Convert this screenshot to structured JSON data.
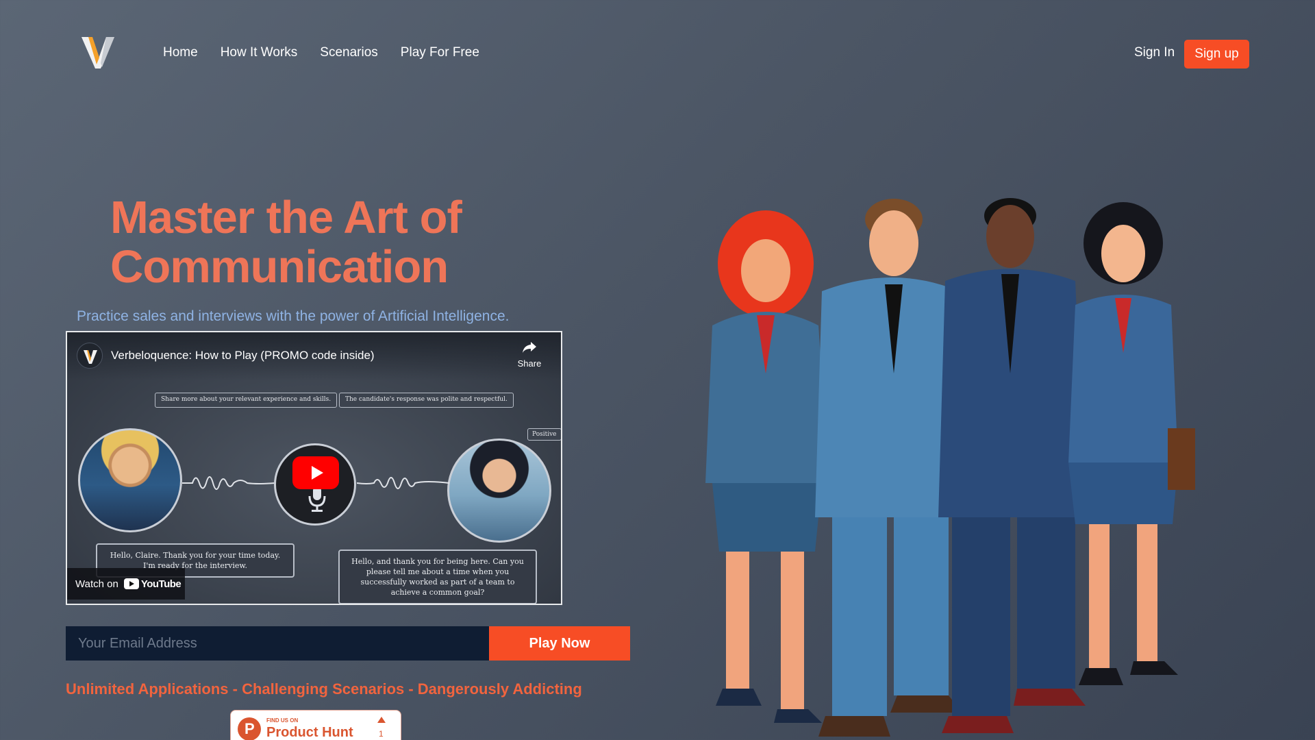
{
  "brand": {
    "logo_icon": "v-logo-icon",
    "accent": "#f74d25"
  },
  "nav": {
    "items": [
      {
        "label": "Home"
      },
      {
        "label": "How It Works"
      },
      {
        "label": "Scenarios"
      },
      {
        "label": "Play For Free"
      }
    ],
    "sign_in": "Sign In",
    "sign_up": "Sign up"
  },
  "hero": {
    "title_line1": "Master the Art of",
    "title_line2": "Communication",
    "subtitle": "Practice sales and interviews with the power of Artificial Intelligence."
  },
  "video": {
    "title": "Verbeloquence: How to Play (PROMO code inside)",
    "share_label": "Share",
    "prompt_left": "Share more about your relevant experience and skills.",
    "prompt_right": "The candidate's response was polite and respectful.",
    "tag": "Positive",
    "bubble_left": "Hello, Claire. Thank you for your time today. I'm ready for the interview.",
    "bubble_right": "Hello, and thank you for being here. Can you please tell me about a time when you successfully worked as part of a team to achieve a common goal?",
    "watch_on": "Watch on",
    "youtube": "YouTube"
  },
  "signup_form": {
    "email_placeholder": "Your Email Address",
    "button": "Play Now"
  },
  "tagline": "Unlimited Applications - Challenging Scenarios - Dangerously Addicting",
  "product_hunt": {
    "small": "FIND US ON",
    "name": "Product Hunt",
    "votes": "1"
  }
}
